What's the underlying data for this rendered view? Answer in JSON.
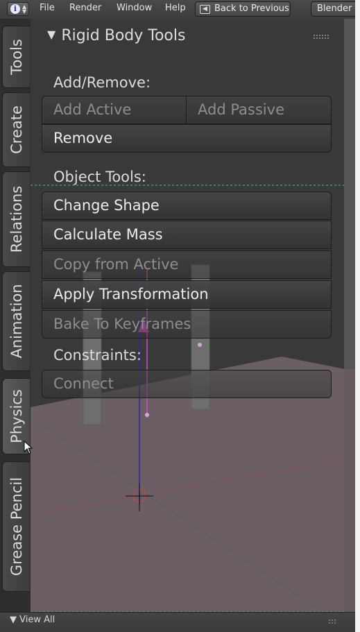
{
  "menubar": {
    "info_icon": "info-icon",
    "items": [
      "File",
      "Render",
      "Window",
      "Help"
    ],
    "back_button": "Back to Previous",
    "engine_button": "Blender"
  },
  "tabs": [
    {
      "label": "Tools",
      "active": false
    },
    {
      "label": "Create",
      "active": false
    },
    {
      "label": "Relations",
      "active": false
    },
    {
      "label": "Animation",
      "active": false
    },
    {
      "label": "Physics",
      "active": true
    },
    {
      "label": "Grease Pencil",
      "active": false
    }
  ],
  "panel": {
    "title": "Rigid Body Tools",
    "add_remove_label": "Add/Remove:",
    "add_active": "Add Active",
    "add_passive": "Add Passive",
    "remove": "Remove",
    "object_tools_label": "Object Tools:",
    "change_shape": "Change Shape",
    "calculate_mass": "Calculate Mass",
    "copy_from_active": "Copy from Active",
    "apply_transformation": "Apply Transformation",
    "bake_to_keyframes": "Bake To Keyframes",
    "constraints_label": "Constraints:",
    "connect": "Connect"
  },
  "bottombar": {
    "view_all": "View All"
  },
  "colors": {
    "ground": "#6b5f65",
    "pillar": "#707070",
    "accent_dashed_line": "#3fb8d8",
    "selection": "#d04fc8"
  }
}
